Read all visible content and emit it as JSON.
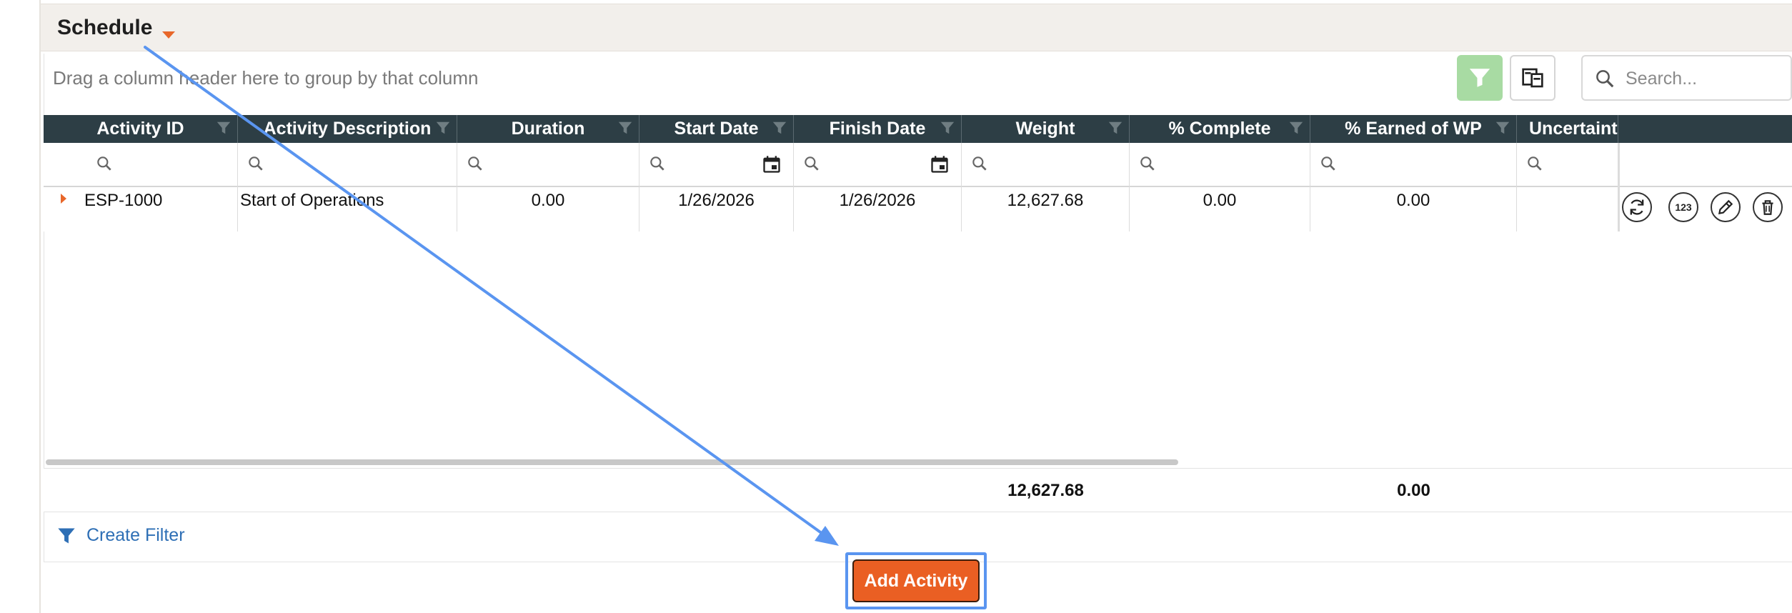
{
  "section": {
    "title": "Schedule"
  },
  "toolbar": {
    "group_hint": "Drag a column header here to group by that column",
    "search_placeholder": "Search..."
  },
  "grid": {
    "columns": [
      "Activity ID",
      "Activity Description",
      "Duration",
      "Start Date",
      "Finish Date",
      "Weight",
      "% Complete",
      "% Earned of WP",
      "Uncertaint"
    ],
    "rows": [
      {
        "activity_id": "ESP-1000",
        "description": "Start of Operations",
        "duration": "0.00",
        "start": "1/26/2026",
        "finish": "1/26/2026",
        "weight": "12,627.68",
        "pct_complete": "0.00",
        "pct_earned": "0.00",
        "uncertainty": ""
      }
    ],
    "totals": {
      "weight": "12,627.68",
      "pct_earned": "0.00"
    }
  },
  "actions": {
    "create_filter": "Create Filter",
    "add_activity": "Add Activity",
    "row_icons": [
      "refresh-icon",
      "number-icon",
      "edit-icon",
      "delete-icon"
    ]
  },
  "colors": {
    "accent": "#ea5f23",
    "header_bg": "#2d3e45",
    "link": "#2e6fb5",
    "filter_button": "#a8dba3",
    "annotation": "#5a95f0"
  }
}
